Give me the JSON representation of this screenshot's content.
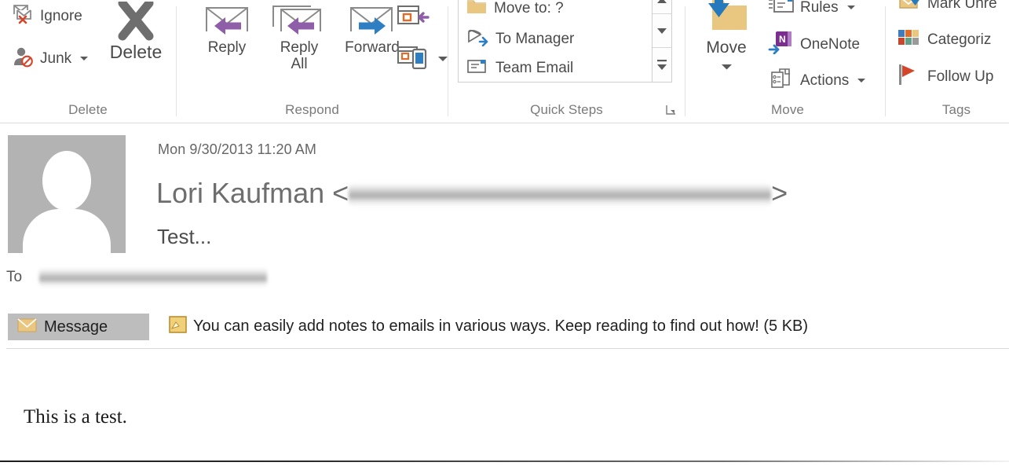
{
  "ribbon": {
    "groups": [
      {
        "name": "delete",
        "label": "Delete",
        "items": [
          {
            "label": "Ignore",
            "icon": "ignore-icon"
          },
          {
            "label": "Junk",
            "icon": "junk-icon",
            "has_dropdown": true
          },
          {
            "label": "Delete",
            "icon": "delete-x-icon"
          }
        ]
      },
      {
        "name": "respond",
        "label": "Respond",
        "items": [
          {
            "label": "Reply",
            "icon": "reply-icon"
          },
          {
            "label": "Reply All",
            "icon": "reply-all-icon"
          },
          {
            "label": "Forward",
            "icon": "forward-icon"
          },
          {
            "label": "",
            "icon": "meeting-icon"
          },
          {
            "label": "",
            "icon": "more-respond-icon",
            "has_dropdown": true
          }
        ]
      },
      {
        "name": "quick-steps",
        "label": "Quick Steps",
        "items": [
          {
            "label": "Move to: ?",
            "icon": "folder-move-icon"
          },
          {
            "label": "To Manager",
            "icon": "to-manager-icon"
          },
          {
            "label": "Team Email",
            "icon": "team-email-icon"
          }
        ],
        "has_launcher": true,
        "scroll_buttons": [
          "scroll-up-icon",
          "scroll-down-icon",
          "more-options-icon"
        ]
      },
      {
        "name": "move",
        "label": "Move",
        "items": [
          {
            "label": "Move",
            "icon": "move-folder-icon",
            "has_dropdown": true
          },
          {
            "label": "Rules",
            "icon": "rules-icon",
            "has_dropdown": true
          },
          {
            "label": "OneNote",
            "icon": "onenote-icon"
          },
          {
            "label": "Actions",
            "icon": "actions-icon",
            "has_dropdown": true
          }
        ]
      },
      {
        "name": "tags",
        "label": "Tags",
        "items": [
          {
            "label": "Mark Unre",
            "icon": "mark-unread-icon"
          },
          {
            "label": "Categoriz",
            "icon": "categorize-icon"
          },
          {
            "label": "Follow Up",
            "icon": "follow-up-flag-icon"
          }
        ]
      }
    ]
  },
  "message": {
    "date": "Mon 9/30/2013 11:20 AM",
    "sender_name": "Lori Kaufman",
    "sender_email_open": "<",
    "sender_email_close": ">",
    "subject": "Test...",
    "to_label": "To",
    "body": "This is a test."
  },
  "attachment_bar": {
    "tab_label": "Message",
    "tab_icon": "envelope-icon",
    "attachment_icon": "note-attachment-icon",
    "attachment_label": "You can easily add notes to emails in various ways. Keep reading to find out how! (5 KB)"
  },
  "colors": {
    "accent_purple": "#8e5ea8",
    "accent_blue": "#2e7ec4",
    "accent_orange": "#e06c27",
    "folder_tan": "#e8c display",
    "tan": "#eac781",
    "onenote_purple": "#7a2f8f",
    "flag_red": "#d4452a",
    "text_gray": "#4a4a4a",
    "label_gray": "#7a7a7a"
  }
}
